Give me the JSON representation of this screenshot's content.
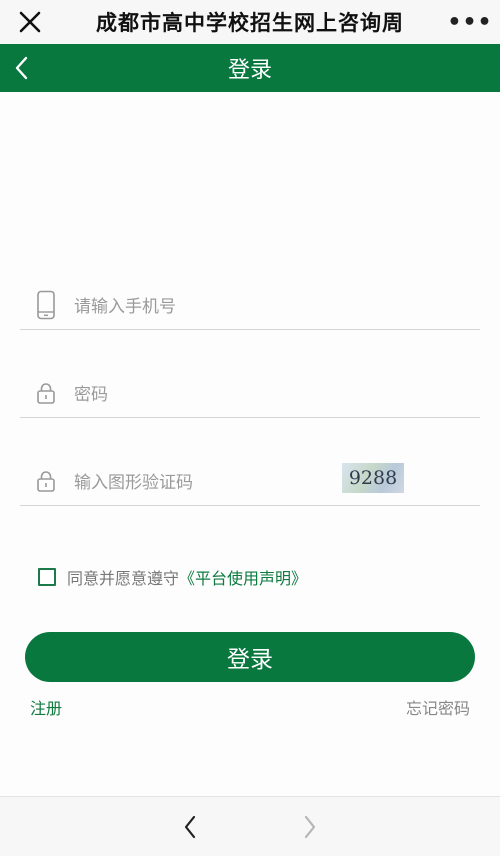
{
  "wechat_bar": {
    "title": "成都市高中学校招生网上咨询周",
    "more_label": "•••",
    "close_icon": "close-icon",
    "more_icon": "more-icon"
  },
  "header": {
    "title": "登录",
    "back_icon": "chevron-left-icon",
    "color": "#08783e"
  },
  "form": {
    "phone_placeholder": "请输入手机号",
    "password_placeholder": "密码",
    "captcha_placeholder": "输入图形验证码",
    "captcha_text": "9288"
  },
  "agreement": {
    "text": "同意并愿意遵守",
    "link": "《平台使用声明》"
  },
  "login_button_label": "登录",
  "register_label": "注册",
  "forgot_label": "忘记密码",
  "bottom_nav": {
    "back_icon": "chevron-left-icon",
    "forward_icon": "chevron-right-icon"
  }
}
